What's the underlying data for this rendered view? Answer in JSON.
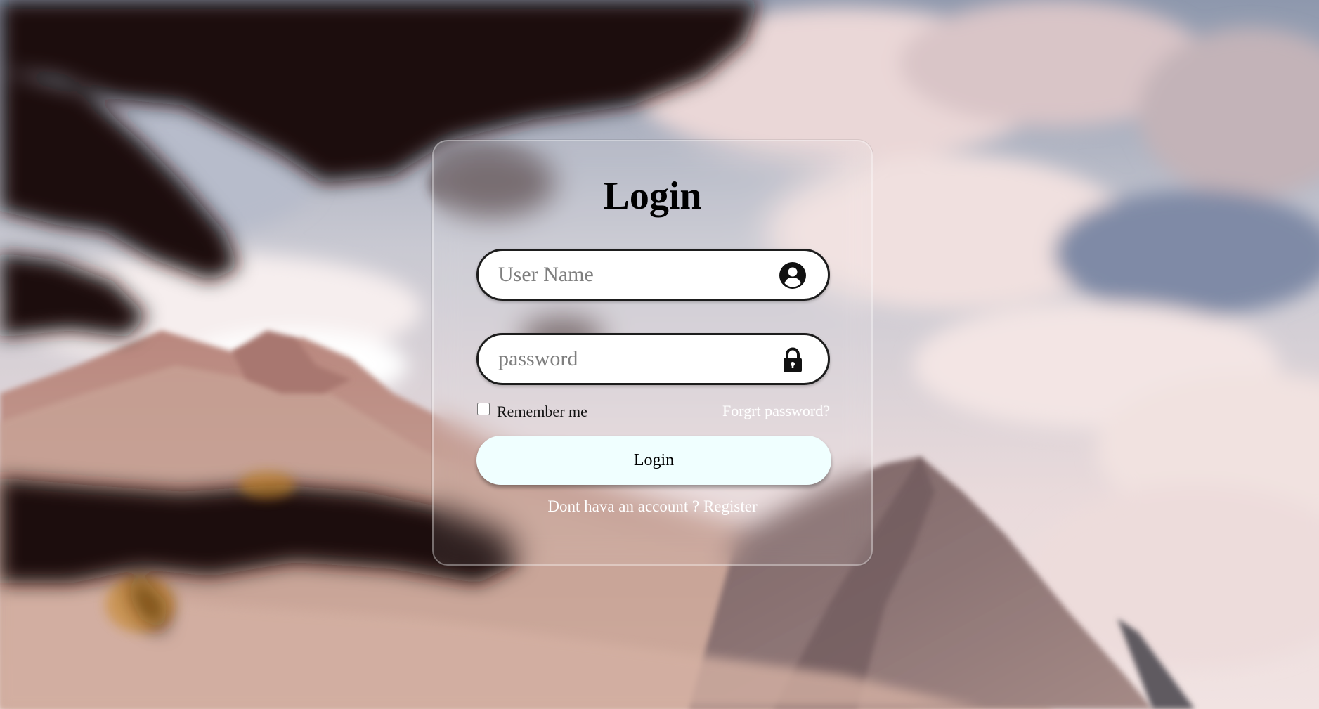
{
  "login": {
    "title": "Login",
    "username_placeholder": "User Name",
    "password_placeholder": "password",
    "remember_label": "Remember me",
    "forgot_label": "Forgrt password?",
    "button_label": "Login",
    "register_prompt": "Dont hava an account ? ",
    "register_link": "Register"
  },
  "icons": {
    "username": "user-circle-icon",
    "password": "lock-icon"
  },
  "colors": {
    "button_bg": "#f0ffff",
    "field_border": "#1d1d1d",
    "link_text": "#ffffff"
  }
}
